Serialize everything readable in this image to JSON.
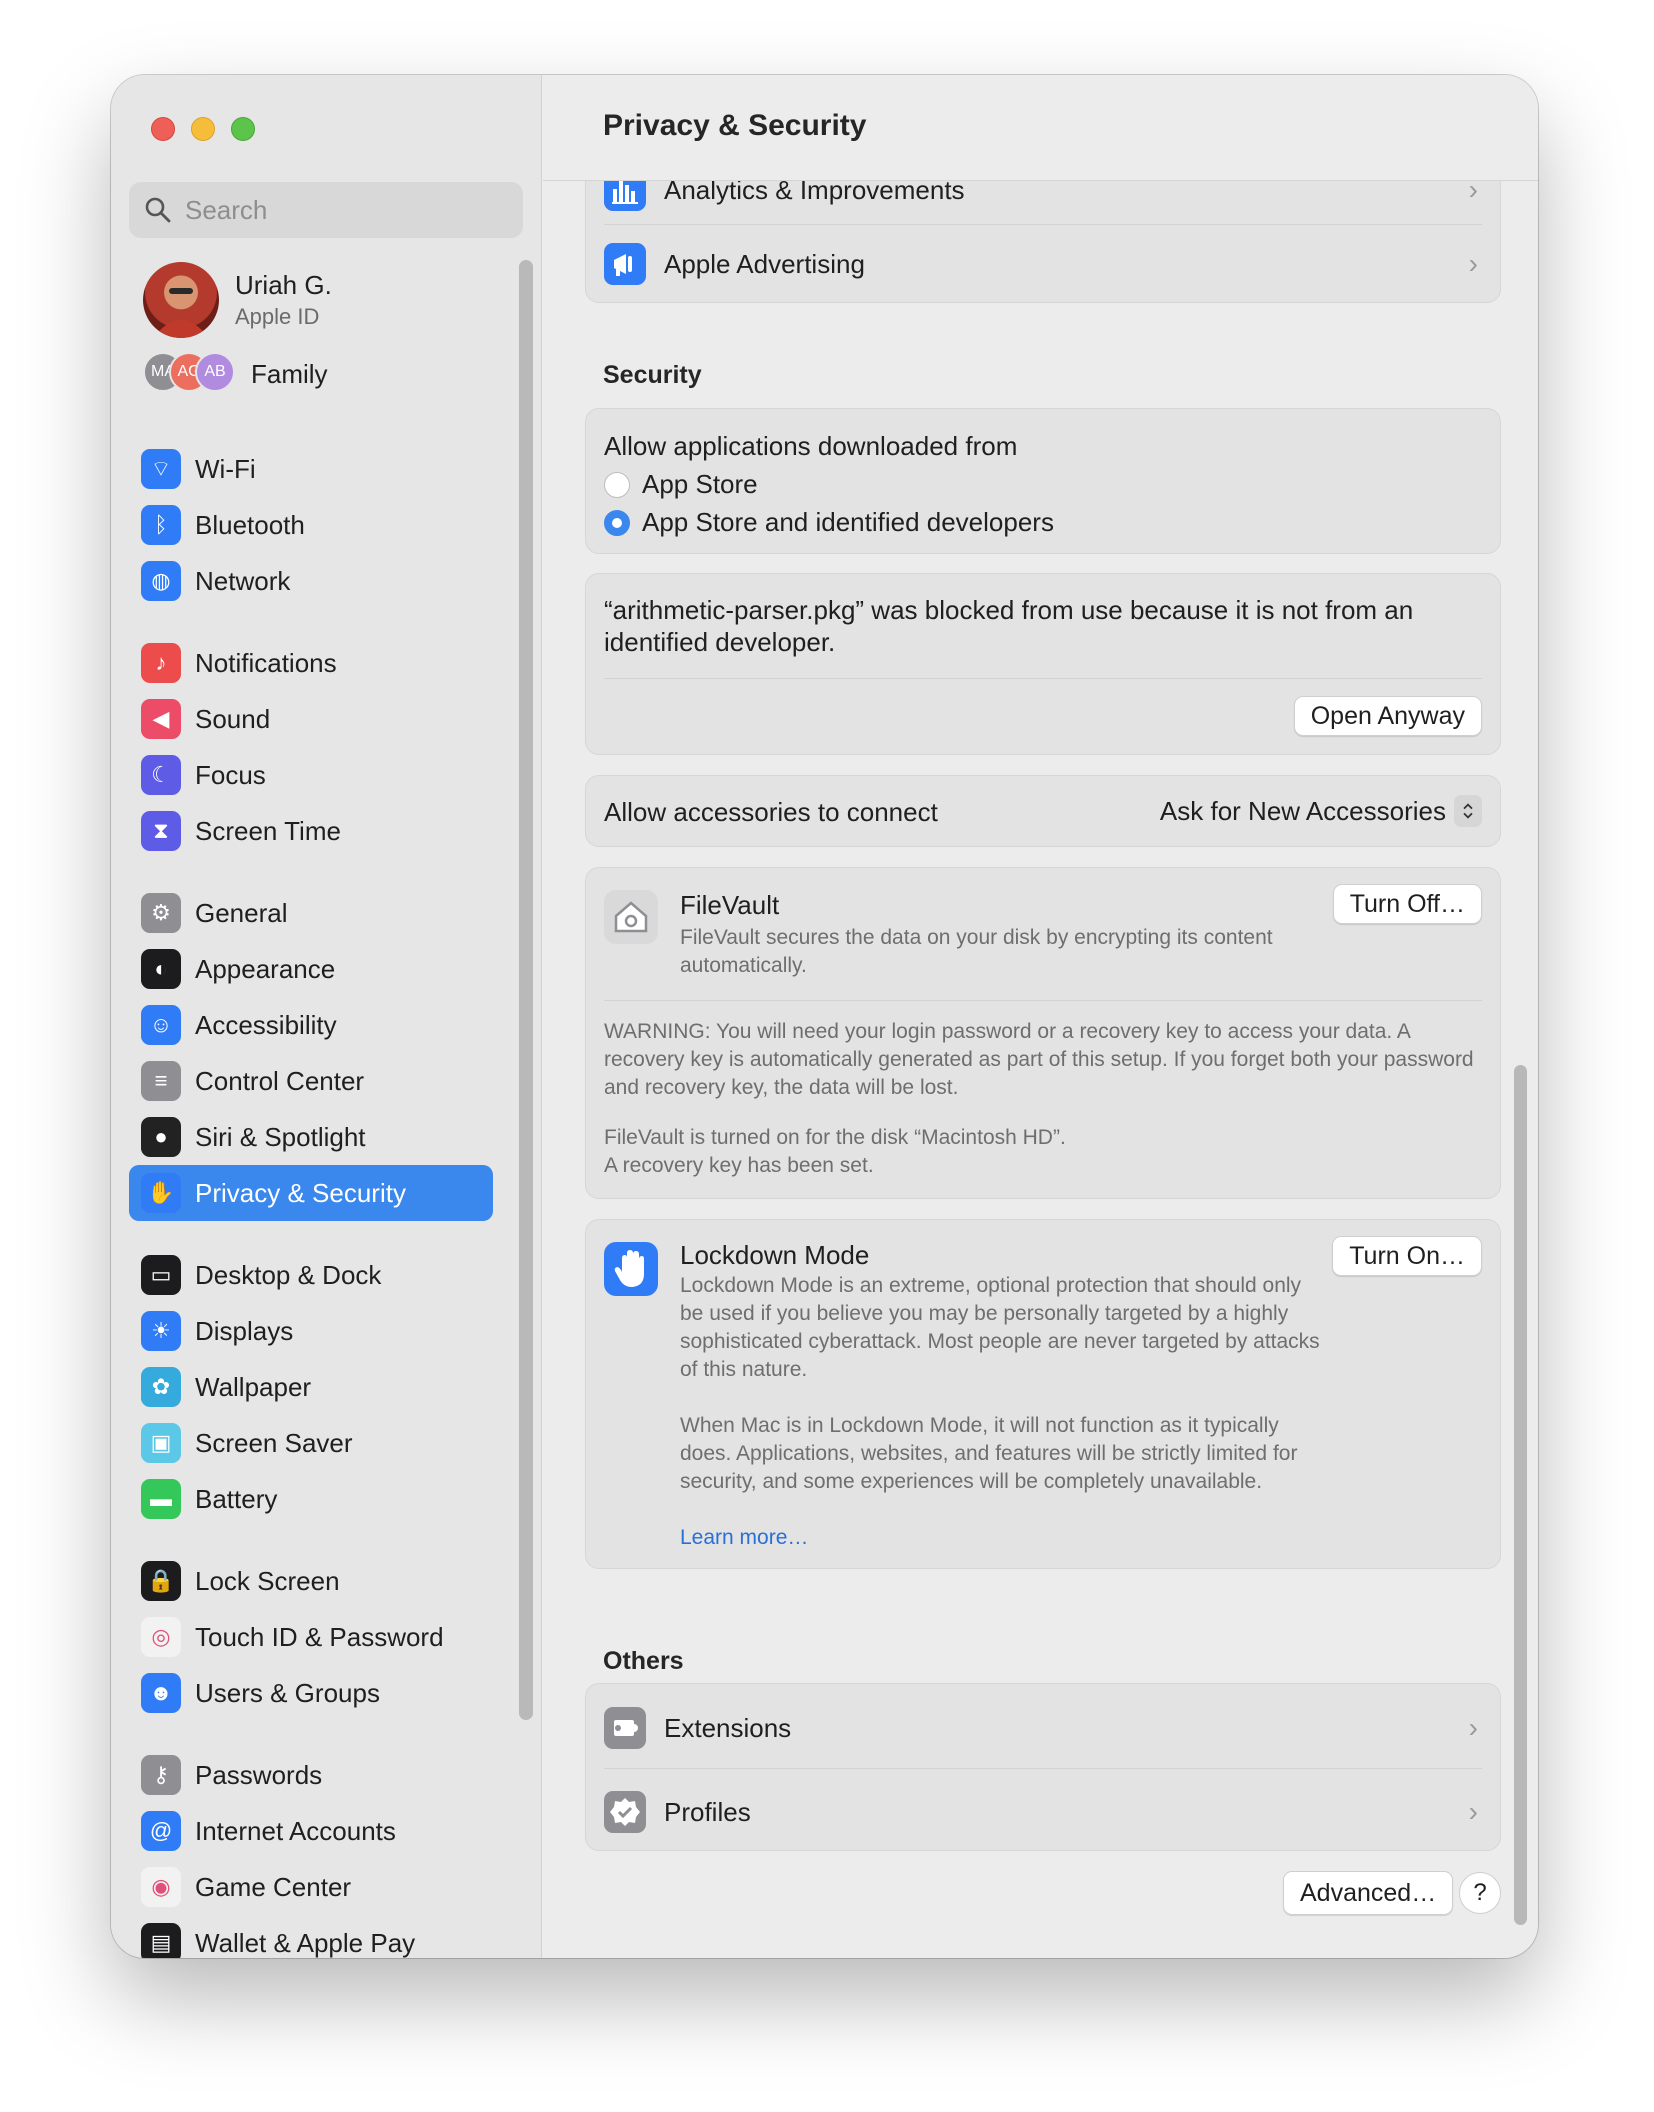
{
  "sidebar": {
    "search_placeholder": "Search",
    "profile": {
      "name": "Uriah G.",
      "subtitle": "Apple ID"
    },
    "family": {
      "label": "Family",
      "avatars": [
        "MA",
        "AG",
        "AB"
      ]
    },
    "items": [
      {
        "label": "Wi-Fi",
        "icon": "wifi-icon",
        "color": "#2f7cf6"
      },
      {
        "label": "Bluetooth",
        "icon": "bluetooth-icon",
        "color": "#2f7cf6"
      },
      {
        "label": "Network",
        "icon": "globe-icon",
        "color": "#2f7cf6"
      },
      {
        "label": "Notifications",
        "icon": "bell-icon",
        "color": "#ec4c4b"
      },
      {
        "label": "Sound",
        "icon": "speaker-icon",
        "color": "#ec4c68"
      },
      {
        "label": "Focus",
        "icon": "moon-icon",
        "color": "#5e5ce6"
      },
      {
        "label": "Screen Time",
        "icon": "hourglass-icon",
        "color": "#5e5ce6"
      },
      {
        "label": "General",
        "icon": "gear-icon",
        "color": "#8e8e93"
      },
      {
        "label": "Appearance",
        "icon": "appearance-icon",
        "color": "#1c1c1e"
      },
      {
        "label": "Accessibility",
        "icon": "accessibility-icon",
        "color": "#2f7cf6"
      },
      {
        "label": "Control Center",
        "icon": "toggles-icon",
        "color": "#8e8e93"
      },
      {
        "label": "Siri & Spotlight",
        "icon": "siri-icon",
        "color": "#222222"
      },
      {
        "label": "Privacy & Security",
        "icon": "hand-icon",
        "color": "#2f7cf6"
      },
      {
        "label": "Desktop & Dock",
        "icon": "dock-icon",
        "color": "#1c1c1e"
      },
      {
        "label": "Displays",
        "icon": "sun-icon",
        "color": "#2f7cf6"
      },
      {
        "label": "Wallpaper",
        "icon": "flower-icon",
        "color": "#35aadc"
      },
      {
        "label": "Screen Saver",
        "icon": "screensaver-icon",
        "color": "#5ac8e6"
      },
      {
        "label": "Battery",
        "icon": "battery-icon",
        "color": "#34c759"
      },
      {
        "label": "Lock Screen",
        "icon": "lock-icon",
        "color": "#1c1c1e"
      },
      {
        "label": "Touch ID & Password",
        "icon": "fingerprint-icon",
        "color": "#f2f2f2"
      },
      {
        "label": "Users & Groups",
        "icon": "users-icon",
        "color": "#2f7cf6"
      },
      {
        "label": "Passwords",
        "icon": "key-icon",
        "color": "#8e8e93"
      },
      {
        "label": "Internet Accounts",
        "icon": "at-icon",
        "color": "#2f7cf6"
      },
      {
        "label": "Game Center",
        "icon": "gamecenter-icon",
        "color": "#f2f2f2"
      },
      {
        "label": "Wallet & Apple Pay",
        "icon": "wallet-icon",
        "color": "#1c1c1e"
      }
    ],
    "selected": "Privacy & Security"
  },
  "main": {
    "title": "Privacy & Security",
    "privacy_rows": [
      {
        "label": "Analytics & Improvements",
        "icon": "chart-icon"
      },
      {
        "label": "Apple Advertising",
        "icon": "megaphone-icon"
      }
    ],
    "security": {
      "heading": "Security",
      "allow_label": "Allow applications downloaded from",
      "options": [
        "App Store",
        "App Store and identified developers"
      ],
      "selected_option": "App Store and identified developers",
      "blocked_message": "“arithmetic-parser.pkg” was blocked from use because it is not from an identified developer.",
      "open_anyway": "Open Anyway",
      "accessories_label": "Allow accessories to connect",
      "accessories_value": "Ask for New Accessories",
      "filevault": {
        "title": "FileVault",
        "description": "FileVault secures the data on your disk by encrypting its content automatically.",
        "button": "Turn Off…",
        "warning": "WARNING: You will need your login password or a recovery key to access your data. A recovery key is automatically generated as part of this setup. If you forget both your password and recovery key, the data will be lost.",
        "status_line1": "FileVault is turned on for the disk “Macintosh HD”.",
        "status_line2": "A recovery key has been set."
      },
      "lockdown": {
        "title": "Lockdown Mode",
        "button": "Turn On…",
        "para1": "Lockdown Mode is an extreme, optional protection that should only be used if you believe you may be personally targeted by a highly sophisticated cyberattack. Most people are never targeted by attacks of this nature.",
        "para2": "When Mac is in Lockdown Mode, it will not function as it typically does. Applications, websites, and features will be strictly limited for security, and some experiences will be completely unavailable.",
        "learn_more": "Learn more…"
      }
    },
    "others": {
      "heading": "Others",
      "rows": [
        {
          "label": "Extensions",
          "icon": "puzzle-icon"
        },
        {
          "label": "Profiles",
          "icon": "checkmark-badge-icon"
        }
      ]
    },
    "advanced_button": "Advanced…",
    "help_button": "?"
  }
}
